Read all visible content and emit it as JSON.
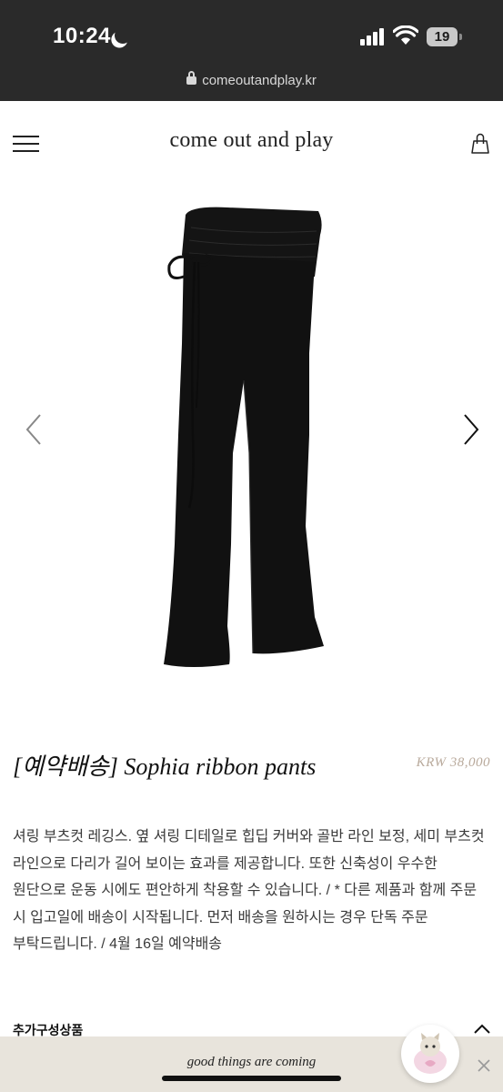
{
  "status_bar": {
    "time": "10:24",
    "battery": "19",
    "url": "comeoutandplay.kr"
  },
  "header": {
    "brand": "come out and play",
    "menu_icon": "hamburger-menu-icon",
    "cart_icon": "shopping-bag-icon"
  },
  "product": {
    "image_desc_icon": "black-flared-pants-photo",
    "title": "[예약배송] Sophia ribbon pants",
    "price": "KRW 38,000",
    "description": "셔링 부츠컷 레깅스. 옆 셔링 디테일로 힙딥 커버와 골반 라인 보정, 세미 부츠컷 라인으로 다리가 길어 보이는 효과를 제공합니다. 또한 신축성이 우수한 원단으로 운동 시에도 편안하게 착용할 수 있습니다. / * 다른 제품과 함께 주문 시 입고일에 배송이 시작됩니다. 먼저 배송을 원하시는 경우 단독 주문 부탁드립니다. / 4월 16일 예약배송",
    "options_label": "추가구성상품"
  },
  "banner": {
    "text": "good things are coming"
  },
  "colors": {
    "status_bg": "#2a2a2a",
    "price": "#b9aa9c",
    "banner_bg": "#e8e4dc"
  }
}
